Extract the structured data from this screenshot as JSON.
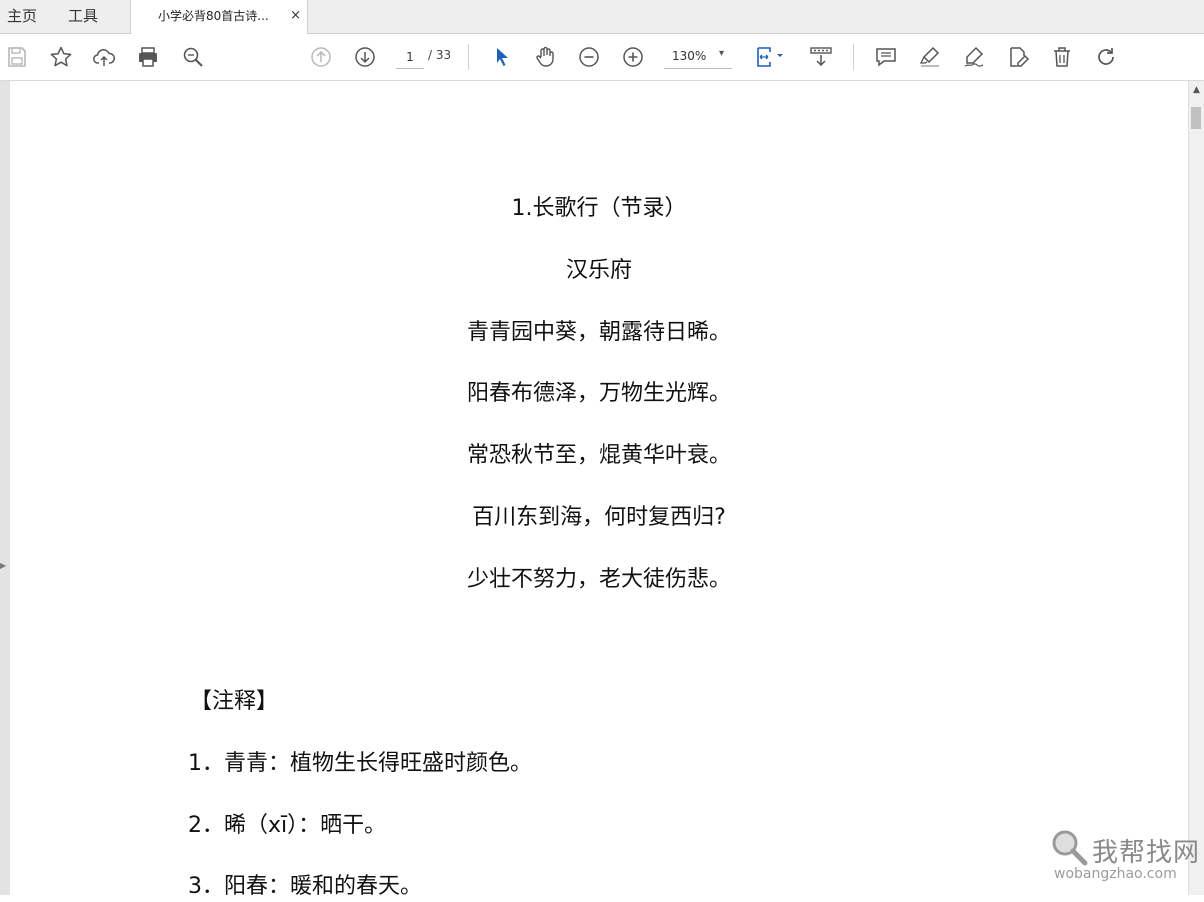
{
  "tabs": {
    "home": "主页",
    "tools": "工具",
    "document": "小学必背80首古诗...",
    "close_symbol": "×"
  },
  "toolbar": {
    "page_current": "1",
    "page_total": "/ 33",
    "zoom": "130%",
    "zoom_caret": "▾",
    "accent_color": "#1f5fb8"
  },
  "document": {
    "title": "1.长歌行（节录）",
    "author": "汉乐府",
    "poem": [
      "青青园中葵，朝露待日晞。",
      "阳春布德泽，万物生光辉。",
      "常恐秋节至，焜黄华叶衰。",
      "百川东到海，何时复西归?",
      "少壮不努力，老大徒伤悲。"
    ],
    "notes_heading": "【注释】",
    "notes": [
      "1．青青：植物生长得旺盛时颜色。",
      "2．晞（xī）：晒干。",
      "3．阳春：暖和的春天。"
    ]
  },
  "watermark": {
    "text": "我帮找网",
    "sub": "wobangzhao.com"
  }
}
